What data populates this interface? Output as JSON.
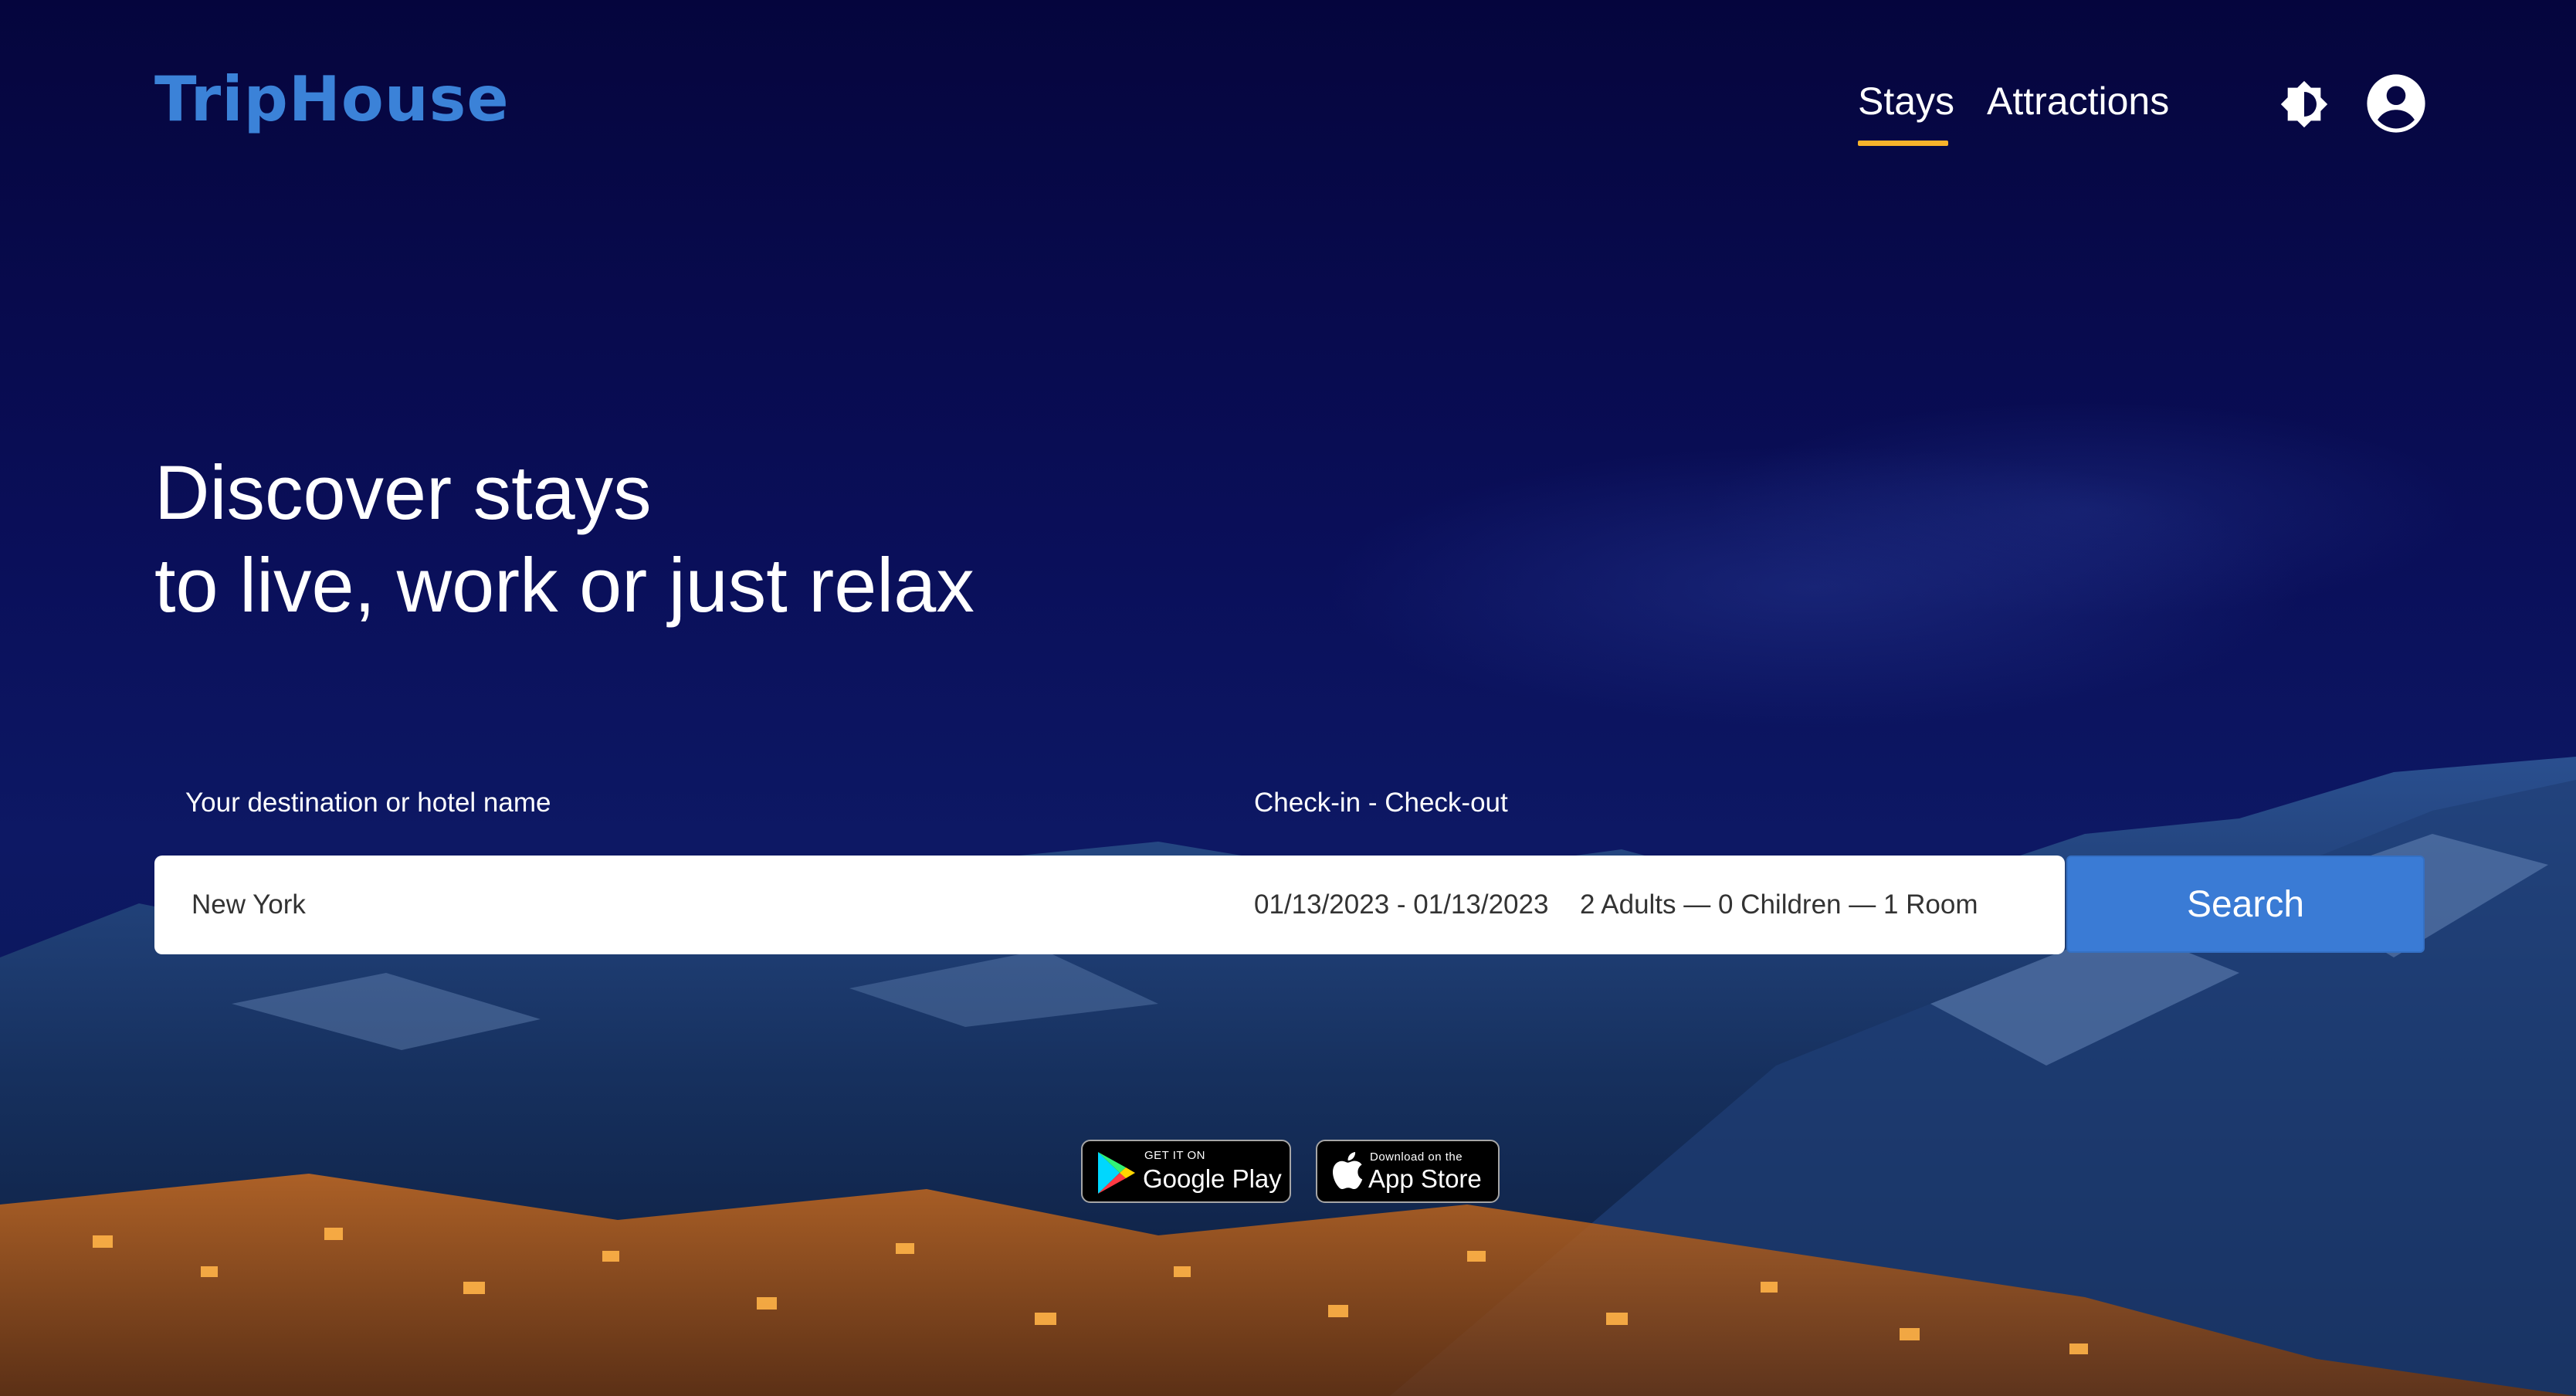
{
  "brand": {
    "name": "TripHouse",
    "color": "#3b82d8"
  },
  "nav": {
    "items": [
      {
        "label": "Stays",
        "active": true
      },
      {
        "label": "Attractions",
        "active": false
      }
    ],
    "active_color": "#f7b32b",
    "icons": {
      "theme": "brightness-icon",
      "account": "account-circle-icon"
    }
  },
  "hero": {
    "line1": "Discover stays",
    "line2": "to live, work or just relax"
  },
  "search": {
    "destination_label": "Your destination or hotel name",
    "dates_label": "Check-in - Check-out",
    "destination_value": "New York",
    "dates_value": "01/13/2023 - 01/13/2023",
    "guests_value": "2 Adults — 0 Children — 1 Room",
    "button_label": "Search",
    "button_color": "#3a7bd5"
  },
  "stores": {
    "google": {
      "small": "GET IT ON",
      "big": "Google Play",
      "icon": "google-play-icon"
    },
    "apple": {
      "small": "Download on the",
      "big": "App Store",
      "icon": "apple-icon"
    }
  }
}
